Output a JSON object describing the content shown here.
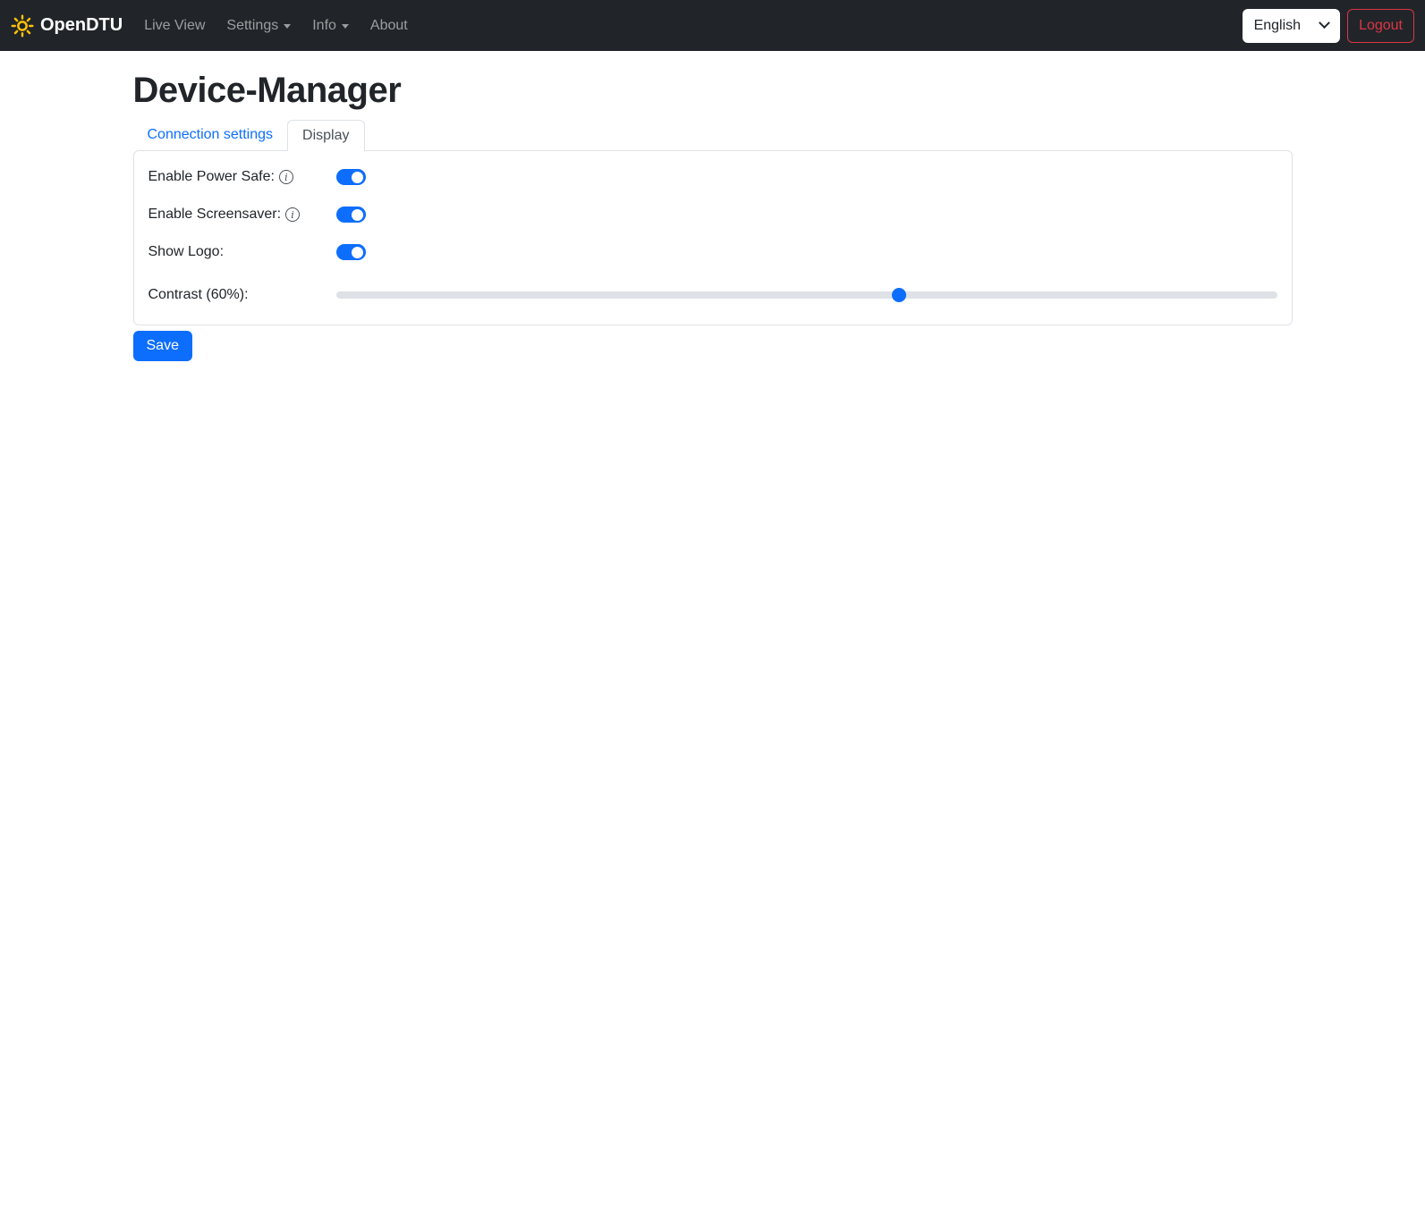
{
  "navbar": {
    "brand": "OpenDTU",
    "items": [
      {
        "label": "Live View",
        "dropdown": false
      },
      {
        "label": "Settings",
        "dropdown": true
      },
      {
        "label": "Info",
        "dropdown": true
      },
      {
        "label": "About",
        "dropdown": false
      }
    ],
    "language": {
      "selected": "English"
    },
    "logout_label": "Logout"
  },
  "page": {
    "title": "Device-Manager"
  },
  "tabs": [
    {
      "label": "Connection settings",
      "active": false
    },
    {
      "label": "Display",
      "active": true
    }
  ],
  "form": {
    "fields": [
      {
        "label": "Enable Power Safe:",
        "type": "switch",
        "on": true,
        "info": true
      },
      {
        "label": "Enable Screensaver:",
        "type": "switch",
        "on": true,
        "info": true
      },
      {
        "label": "Show Logo:",
        "type": "switch",
        "on": true,
        "info": false
      },
      {
        "label": "Contrast (60%):",
        "type": "range",
        "value_percent": 60,
        "min": 0,
        "max": 100
      }
    ],
    "save_label": "Save"
  },
  "icons": {
    "info_glyph": "i"
  },
  "colors": {
    "navbar_bg": "#212529",
    "accent_blue": "#0d6efd",
    "danger_red": "#dc3545",
    "border_gray": "#dee2e6",
    "text_dark": "#212529",
    "sun_yellow": "#ffc107",
    "nav_link_gray": "rgba(255,255,255,0.55)"
  }
}
